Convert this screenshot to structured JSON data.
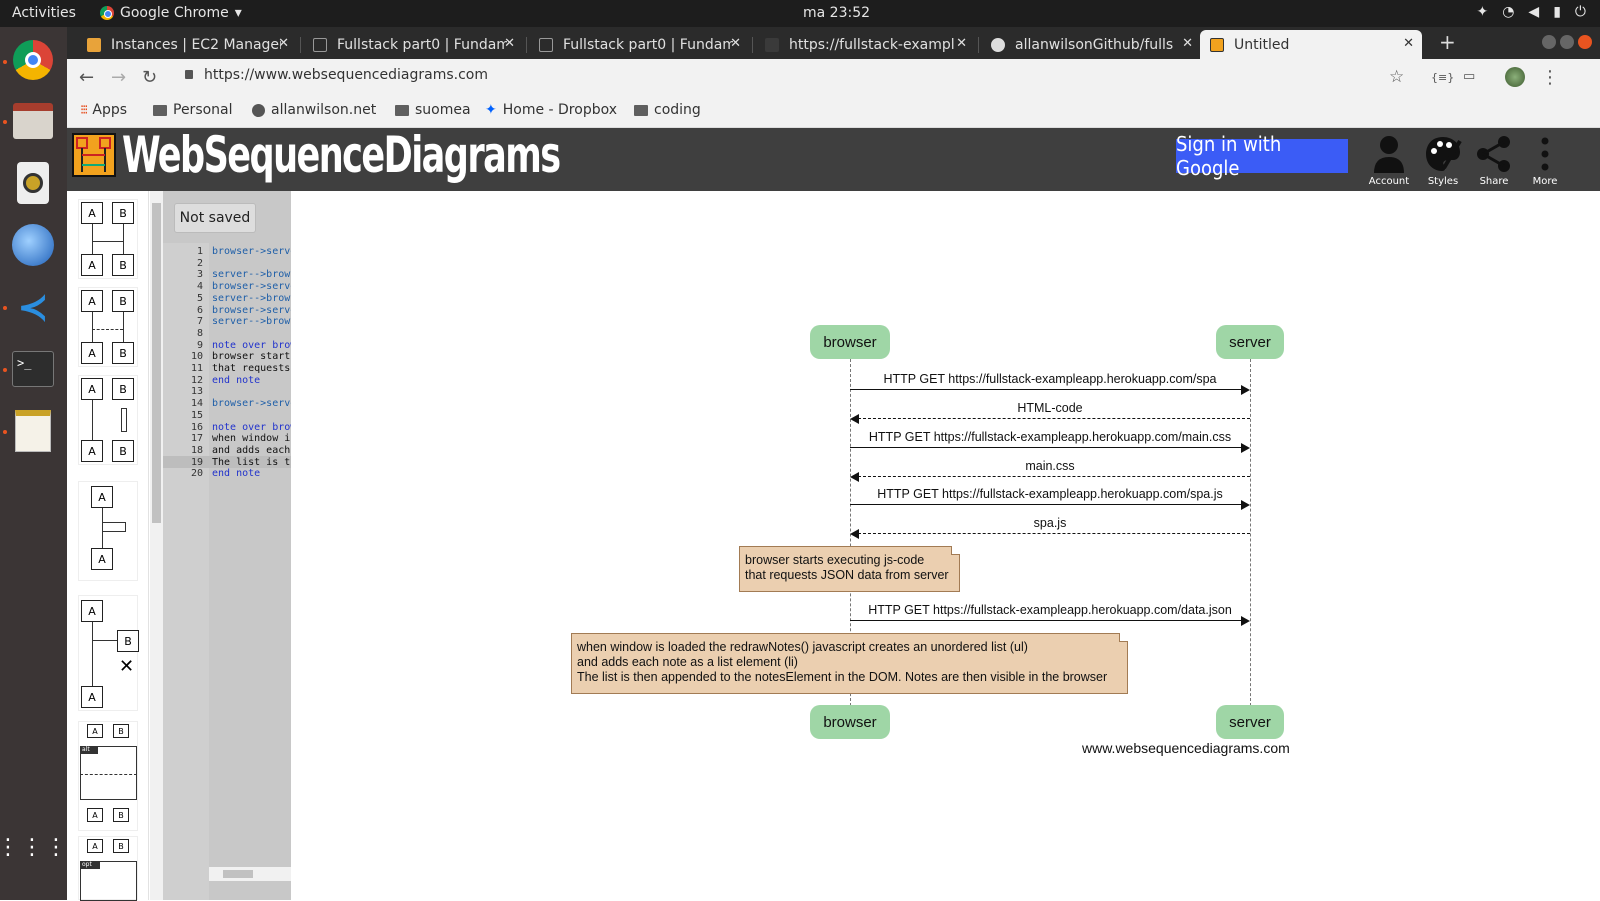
{
  "os": {
    "activities": "Activities",
    "app_name": "Google Chrome",
    "clock": "ma 23:52"
  },
  "browser": {
    "tabs": [
      {
        "title": "Instances | EC2 Manager"
      },
      {
        "title": "Fullstack part0 | Fundam"
      },
      {
        "title": "Fullstack part0 | Fundam"
      },
      {
        "title": "https://fullstack-exampl"
      },
      {
        "title": "allanwilsonGithub/fulls"
      },
      {
        "title": "Untitled"
      }
    ],
    "url": "https://www.websequencediagrams.com",
    "bookmarks": [
      {
        "label": "Apps"
      },
      {
        "label": "Personal"
      },
      {
        "label": "allanwilson.net"
      },
      {
        "label": "suomea"
      },
      {
        "label": "Home - Dropbox"
      },
      {
        "label": "coding"
      }
    ]
  },
  "site": {
    "logo_text": "WebSequenceDiagrams",
    "signin_label": "Sign in with Google",
    "toolbar": [
      {
        "label": "Account"
      },
      {
        "label": "Styles"
      },
      {
        "label": "Share"
      },
      {
        "label": "More"
      }
    ]
  },
  "editor": {
    "status": "Not saved",
    "lines": [
      "browser->serve",
      "",
      "server-->brows",
      "browser->serve",
      "server-->brows",
      "browser->serve",
      "server-->brows",
      "",
      "note over brow",
      "browser starts",
      "that requests",
      "end note",
      "",
      "browser->serve",
      "",
      "note over brow",
      "when window is",
      "and adds each",
      "The list is th",
      "end note"
    ]
  },
  "diagram": {
    "actors": [
      "browser",
      "server"
    ],
    "messages": [
      {
        "text": "HTTP GET https://fullstack-exampleapp.herokuapp.com/spa",
        "dir": "right",
        "style": "solid"
      },
      {
        "text": "HTML-code",
        "dir": "left",
        "style": "dashed"
      },
      {
        "text": "HTTP GET https://fullstack-exampleapp.herokuapp.com/main.css",
        "dir": "right",
        "style": "solid"
      },
      {
        "text": "main.css",
        "dir": "left",
        "style": "dashed"
      },
      {
        "text": "HTTP GET https://fullstack-exampleapp.herokuapp.com/spa.js",
        "dir": "right",
        "style": "solid"
      },
      {
        "text": "spa.js",
        "dir": "left",
        "style": "dashed"
      },
      {
        "text": "HTTP GET https://fullstack-exampleapp.herokuapp.com/data.json",
        "dir": "right",
        "style": "solid"
      }
    ],
    "note1": "browser starts executing js-code\nthat requests JSON data from server",
    "note2": "when window is loaded the redrawNotes() javascript creates an unordered list (ul)\nand adds each note as a list element (li)\nThe list is then appended to the notesElement in the DOM. Notes are then visible in the browser",
    "watermark": "www.websequencediagrams.com"
  }
}
